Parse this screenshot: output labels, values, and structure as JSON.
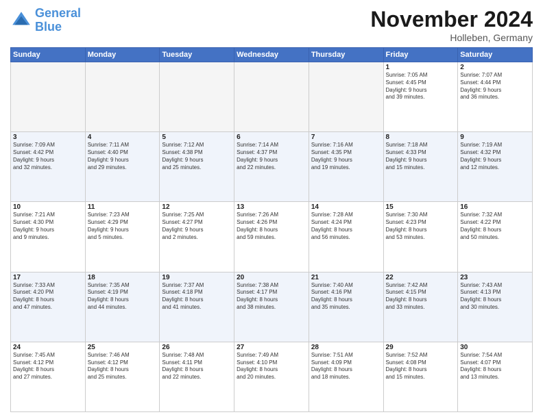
{
  "header": {
    "logo_line1": "General",
    "logo_line2": "Blue",
    "month": "November 2024",
    "location": "Holleben, Germany"
  },
  "weekdays": [
    "Sunday",
    "Monday",
    "Tuesday",
    "Wednesday",
    "Thursday",
    "Friday",
    "Saturday"
  ],
  "weeks": [
    [
      {
        "day": "",
        "info": ""
      },
      {
        "day": "",
        "info": ""
      },
      {
        "day": "",
        "info": ""
      },
      {
        "day": "",
        "info": ""
      },
      {
        "day": "",
        "info": ""
      },
      {
        "day": "1",
        "info": "Sunrise: 7:05 AM\nSunset: 4:45 PM\nDaylight: 9 hours\nand 39 minutes."
      },
      {
        "day": "2",
        "info": "Sunrise: 7:07 AM\nSunset: 4:44 PM\nDaylight: 9 hours\nand 36 minutes."
      }
    ],
    [
      {
        "day": "3",
        "info": "Sunrise: 7:09 AM\nSunset: 4:42 PM\nDaylight: 9 hours\nand 32 minutes."
      },
      {
        "day": "4",
        "info": "Sunrise: 7:11 AM\nSunset: 4:40 PM\nDaylight: 9 hours\nand 29 minutes."
      },
      {
        "day": "5",
        "info": "Sunrise: 7:12 AM\nSunset: 4:38 PM\nDaylight: 9 hours\nand 25 minutes."
      },
      {
        "day": "6",
        "info": "Sunrise: 7:14 AM\nSunset: 4:37 PM\nDaylight: 9 hours\nand 22 minutes."
      },
      {
        "day": "7",
        "info": "Sunrise: 7:16 AM\nSunset: 4:35 PM\nDaylight: 9 hours\nand 19 minutes."
      },
      {
        "day": "8",
        "info": "Sunrise: 7:18 AM\nSunset: 4:33 PM\nDaylight: 9 hours\nand 15 minutes."
      },
      {
        "day": "9",
        "info": "Sunrise: 7:19 AM\nSunset: 4:32 PM\nDaylight: 9 hours\nand 12 minutes."
      }
    ],
    [
      {
        "day": "10",
        "info": "Sunrise: 7:21 AM\nSunset: 4:30 PM\nDaylight: 9 hours\nand 9 minutes."
      },
      {
        "day": "11",
        "info": "Sunrise: 7:23 AM\nSunset: 4:29 PM\nDaylight: 9 hours\nand 5 minutes."
      },
      {
        "day": "12",
        "info": "Sunrise: 7:25 AM\nSunset: 4:27 PM\nDaylight: 9 hours\nand 2 minutes."
      },
      {
        "day": "13",
        "info": "Sunrise: 7:26 AM\nSunset: 4:26 PM\nDaylight: 8 hours\nand 59 minutes."
      },
      {
        "day": "14",
        "info": "Sunrise: 7:28 AM\nSunset: 4:24 PM\nDaylight: 8 hours\nand 56 minutes."
      },
      {
        "day": "15",
        "info": "Sunrise: 7:30 AM\nSunset: 4:23 PM\nDaylight: 8 hours\nand 53 minutes."
      },
      {
        "day": "16",
        "info": "Sunrise: 7:32 AM\nSunset: 4:22 PM\nDaylight: 8 hours\nand 50 minutes."
      }
    ],
    [
      {
        "day": "17",
        "info": "Sunrise: 7:33 AM\nSunset: 4:20 PM\nDaylight: 8 hours\nand 47 minutes."
      },
      {
        "day": "18",
        "info": "Sunrise: 7:35 AM\nSunset: 4:19 PM\nDaylight: 8 hours\nand 44 minutes."
      },
      {
        "day": "19",
        "info": "Sunrise: 7:37 AM\nSunset: 4:18 PM\nDaylight: 8 hours\nand 41 minutes."
      },
      {
        "day": "20",
        "info": "Sunrise: 7:38 AM\nSunset: 4:17 PM\nDaylight: 8 hours\nand 38 minutes."
      },
      {
        "day": "21",
        "info": "Sunrise: 7:40 AM\nSunset: 4:16 PM\nDaylight: 8 hours\nand 35 minutes."
      },
      {
        "day": "22",
        "info": "Sunrise: 7:42 AM\nSunset: 4:15 PM\nDaylight: 8 hours\nand 33 minutes."
      },
      {
        "day": "23",
        "info": "Sunrise: 7:43 AM\nSunset: 4:13 PM\nDaylight: 8 hours\nand 30 minutes."
      }
    ],
    [
      {
        "day": "24",
        "info": "Sunrise: 7:45 AM\nSunset: 4:12 PM\nDaylight: 8 hours\nand 27 minutes."
      },
      {
        "day": "25",
        "info": "Sunrise: 7:46 AM\nSunset: 4:12 PM\nDaylight: 8 hours\nand 25 minutes."
      },
      {
        "day": "26",
        "info": "Sunrise: 7:48 AM\nSunset: 4:11 PM\nDaylight: 8 hours\nand 22 minutes."
      },
      {
        "day": "27",
        "info": "Sunrise: 7:49 AM\nSunset: 4:10 PM\nDaylight: 8 hours\nand 20 minutes."
      },
      {
        "day": "28",
        "info": "Sunrise: 7:51 AM\nSunset: 4:09 PM\nDaylight: 8 hours\nand 18 minutes."
      },
      {
        "day": "29",
        "info": "Sunrise: 7:52 AM\nSunset: 4:08 PM\nDaylight: 8 hours\nand 15 minutes."
      },
      {
        "day": "30",
        "info": "Sunrise: 7:54 AM\nSunset: 4:07 PM\nDaylight: 8 hours\nand 13 minutes."
      }
    ]
  ]
}
